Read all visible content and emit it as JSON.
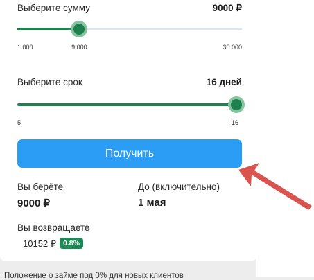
{
  "colors": {
    "accent_green": "#1f8050",
    "halo_green": "#86c4a0",
    "button_blue": "#2b9df4",
    "badge_green": "#1d8a55",
    "arrow_red": "#d9534f"
  },
  "amount": {
    "label": "Выберите сумму",
    "value": "9000 ₽",
    "min_label": "1 000",
    "current_label": "9 000",
    "max_label": "30 000",
    "min": 1000,
    "max": 30000,
    "current": 9000
  },
  "term": {
    "label": "Выберите срок",
    "value": "16 дней",
    "min_label": "5",
    "max_label": "16",
    "min": 5,
    "max": 16,
    "current": 16
  },
  "submit_label": "Получить",
  "summary": {
    "borrow_label": "Вы берёте",
    "borrow_value": "9000 ₽",
    "until_label": "До (включительно)",
    "until_value": "1 мая",
    "return_label": "Вы возвращаете",
    "return_value": "10152 ₽",
    "rate_badge": "0.8%"
  },
  "footnote": "Положение о займе под 0% для новых клиентов",
  "annotation": {
    "icon": "red-arrow-icon"
  }
}
